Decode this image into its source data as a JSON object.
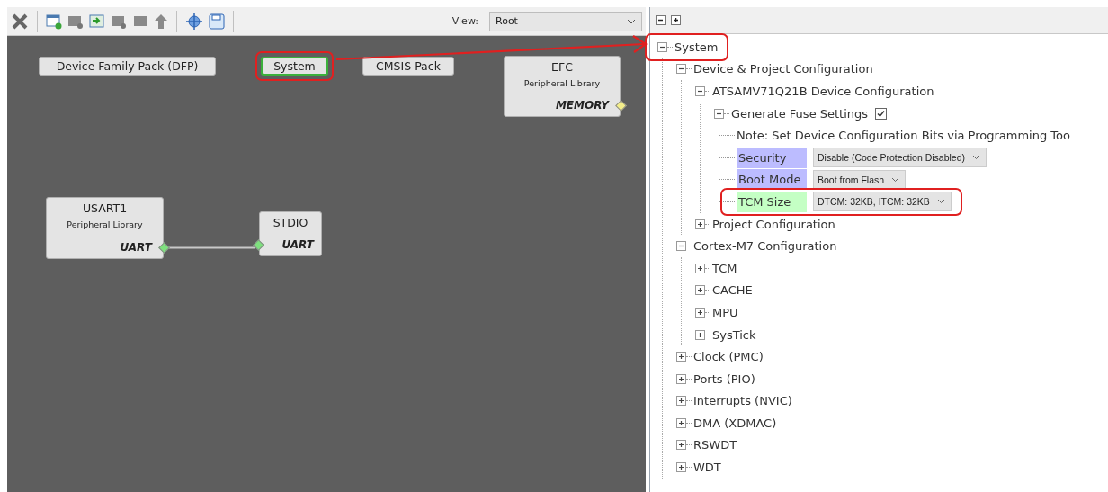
{
  "toolbar": {
    "view_label": "View:",
    "view_value": "Root"
  },
  "canvas": {
    "nodes": [
      {
        "kind": "tag",
        "label": "Device Family Pack (DFP)",
        "selected": false
      },
      {
        "kind": "tag",
        "label": "System",
        "selected": true,
        "highlighted": true
      },
      {
        "kind": "tag",
        "label": "CMSIS Pack",
        "selected": false
      },
      {
        "kind": "component",
        "title": "EFC",
        "subtitle": "Peripheral Library",
        "port": {
          "label": "MEMORY",
          "kind": "output",
          "color": "#f4ee8a"
        }
      },
      {
        "kind": "component",
        "title": "USART1",
        "subtitle": "Peripheral Library",
        "port": {
          "label": "UART",
          "kind": "output",
          "color": "#7ee07e",
          "connected": true
        }
      },
      {
        "kind": "component",
        "title": "STDIO",
        "port": {
          "label": "UART",
          "kind": "input",
          "color": "#7ee07e",
          "connected": true
        }
      }
    ]
  },
  "callout_arrow": true,
  "tree": {
    "items": [
      {
        "kind": "group",
        "label": "System",
        "expanded": true,
        "highlighted": true,
        "children": [
          {
            "kind": "group",
            "label": "Device & Project Configuration",
            "expanded": true,
            "children": [
              {
                "kind": "group",
                "label": "ATSAMV71Q21B Device Configuration",
                "expanded": true,
                "children": [
                  {
                    "kind": "check-group",
                    "label": "Generate Fuse Settings",
                    "expanded": true,
                    "checked": true,
                    "children": [
                      {
                        "kind": "note",
                        "label": "Note: Set Device Configuration Bits via Programming Too"
                      },
                      {
                        "kind": "setting",
                        "label": "Security",
                        "value": "Disable (Code Protection Disabled)",
                        "color": "#bcbcff"
                      },
                      {
                        "kind": "setting",
                        "label": "Boot Mode",
                        "value": "Boot from Flash",
                        "color": "#bcbcff"
                      },
                      {
                        "kind": "setting",
                        "label": "TCM Size",
                        "value": "DTCM: 32KB, ITCM: 32KB",
                        "color": "#c4ffc4",
                        "highlighted": true
                      }
                    ]
                  }
                ]
              },
              {
                "kind": "group",
                "label": "Project Configuration",
                "expanded": false
              }
            ]
          },
          {
            "kind": "group",
            "label": "Cortex-M7 Configuration",
            "expanded": true,
            "children": [
              {
                "kind": "group",
                "label": "TCM",
                "expanded": false
              },
              {
                "kind": "group",
                "label": "CACHE",
                "expanded": false
              },
              {
                "kind": "group",
                "label": "MPU",
                "expanded": false
              },
              {
                "kind": "group",
                "label": "SysTick",
                "expanded": false
              }
            ]
          },
          {
            "kind": "group",
            "label": "Clock (PMC)",
            "expanded": false
          },
          {
            "kind": "group",
            "label": "Ports (PIO)",
            "expanded": false
          },
          {
            "kind": "group",
            "label": "Interrupts (NVIC)",
            "expanded": false
          },
          {
            "kind": "group",
            "label": "DMA (XDMAC)",
            "expanded": false
          },
          {
            "kind": "group",
            "label": "RSWDT",
            "expanded": false
          },
          {
            "kind": "group",
            "label": "WDT",
            "expanded": false
          }
        ]
      }
    ]
  }
}
